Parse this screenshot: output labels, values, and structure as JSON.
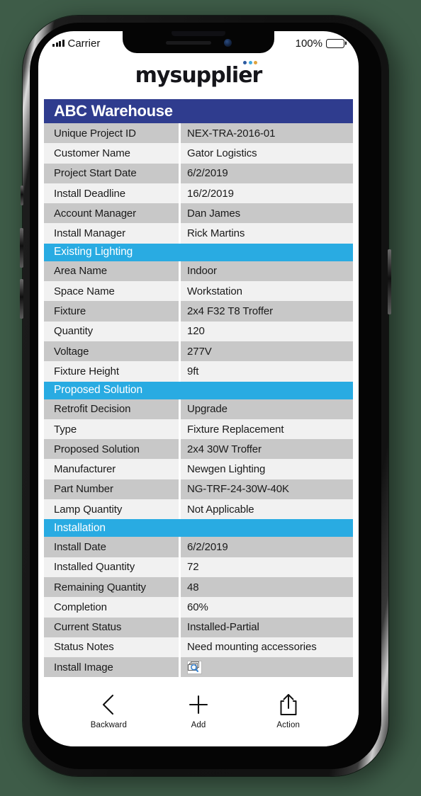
{
  "status_bar": {
    "carrier": "Carrier",
    "battery_percent": "100%",
    "signal_icon": "signal-bars-icon",
    "battery_icon": "battery-full-icon"
  },
  "brand": {
    "logo_text": "mysupplier",
    "dot_colors": [
      "#2c5aa0",
      "#3fa9dd",
      "#e0a33e"
    ]
  },
  "colors": {
    "title_bar": "#2f3c8e",
    "section_bar": "#29abe2",
    "row_shade": "#c8c8c8",
    "row_light": "#f1f1f1",
    "background": "#3e5c48"
  },
  "record": {
    "title": "ABC Warehouse",
    "sections": [
      {
        "header": null,
        "rows": [
          {
            "label": "Unique Project ID",
            "value": "NEX-TRA-2016-01"
          },
          {
            "label": "Customer Name",
            "value": "Gator Logistics"
          },
          {
            "label": "Project Start Date",
            "value": "6/2/2019"
          },
          {
            "label": "Install Deadline",
            "value": "16/2/2019"
          },
          {
            "label": "Account Manager",
            "value": "Dan James"
          },
          {
            "label": "Install Manager",
            "value": "Rick Martins"
          }
        ]
      },
      {
        "header": "Existing Lighting",
        "rows": [
          {
            "label": "Area Name",
            "value": "Indoor"
          },
          {
            "label": "Space Name",
            "value": "Workstation"
          },
          {
            "label": "Fixture",
            "value": "2x4 F32 T8 Troffer"
          },
          {
            "label": "Quantity",
            "value": "120"
          },
          {
            "label": "Voltage",
            "value": "277V"
          },
          {
            "label": "Fixture Height",
            "value": "9ft"
          }
        ]
      },
      {
        "header": "Proposed Solution",
        "rows": [
          {
            "label": "Retrofit Decision",
            "value": "Upgrade"
          },
          {
            "label": "Type",
            "value": "Fixture Replacement"
          },
          {
            "label": "Proposed Solution",
            "value": "2x4 30W Troffer"
          },
          {
            "label": "Manufacturer",
            "value": "Newgen Lighting"
          },
          {
            "label": "Part Number",
            "value": "NG-TRF-24-30W-40K"
          },
          {
            "label": "Lamp Quantity",
            "value": "Not Applicable"
          }
        ]
      },
      {
        "header": "Installation",
        "rows": [
          {
            "label": "Install Date",
            "value": "6/2/2019"
          },
          {
            "label": "Installed Quantity",
            "value": "72"
          },
          {
            "label": "Remaining Quantity",
            "value": "48"
          },
          {
            "label": "Completion",
            "value": "60%"
          },
          {
            "label": "Current Status",
            "value": "Installed-Partial"
          },
          {
            "label": "Status Notes",
            "value": "Need mounting accessories"
          },
          {
            "label": "Install Image",
            "value": "",
            "icon": "image-preview-icon"
          }
        ]
      }
    ]
  },
  "toolbar": {
    "items": [
      {
        "label": "Backward",
        "icon": "chevron-left-icon"
      },
      {
        "label": "Add",
        "icon": "plus-icon"
      },
      {
        "label": "Action",
        "icon": "share-up-icon"
      }
    ]
  }
}
